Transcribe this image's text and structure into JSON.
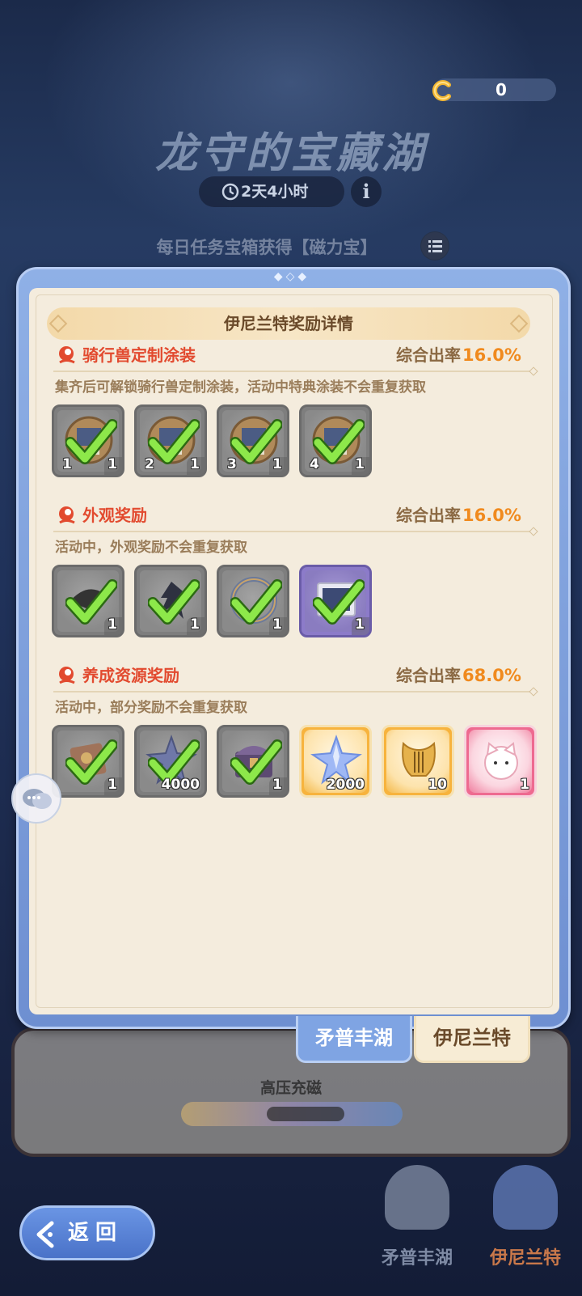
{
  "currency": {
    "value": "0",
    "icon": "horseshoe-magnet-icon"
  },
  "event": {
    "title": "龙守的宝藏湖",
    "timer": "2天4小时",
    "daily_task_text": "每日任务宝箱获得【磁力宝】"
  },
  "modal": {
    "title": "伊尼兰特奖励详情",
    "sections": [
      {
        "title": "骑行兽定制涂装",
        "rate_label": "综合出率",
        "rate_value": "16.0%",
        "desc": "集齐后可解锁骑行兽定制涂装，活动中特典涂装不会重复获取",
        "items": [
          {
            "count": "1",
            "tag": "1",
            "style": "grey",
            "collected": true,
            "icon": "mount-skin-fragment-icon"
          },
          {
            "count": "1",
            "tag": "2",
            "style": "grey",
            "collected": true,
            "icon": "mount-skin-fragment-icon"
          },
          {
            "count": "1",
            "tag": "3",
            "style": "grey",
            "collected": true,
            "icon": "mount-skin-fragment-icon"
          },
          {
            "count": "1",
            "tag": "4",
            "style": "grey",
            "collected": true,
            "icon": "mount-skin-fragment-icon"
          }
        ]
      },
      {
        "title": "外观奖励",
        "rate_label": "综合出率",
        "rate_value": "16.0%",
        "desc": "活动中，外观奖励不会重复获取",
        "items": [
          {
            "count": "1",
            "style": "grey",
            "collected": true,
            "icon": "hat-icon"
          },
          {
            "count": "1",
            "style": "grey",
            "collected": true,
            "icon": "wings-icon"
          },
          {
            "count": "1",
            "style": "grey",
            "collected": true,
            "icon": "avatar-frame-icon"
          },
          {
            "count": "1",
            "style": "purple",
            "collected": true,
            "icon": "photo-frame-icon"
          }
        ]
      },
      {
        "title": "养成资源奖励",
        "rate_label": "综合出率",
        "rate_value": "68.0%",
        "desc": "活动中，部分奖励不会重复获取",
        "items": [
          {
            "count": "1",
            "style": "grey",
            "collected": true,
            "icon": "scroll-icon"
          },
          {
            "count": "4000",
            "style": "grey",
            "collected": true,
            "icon": "star-crystal-icon"
          },
          {
            "count": "1",
            "style": "grey",
            "collected": true,
            "icon": "chest-icon"
          },
          {
            "count": "2000",
            "style": "orange",
            "collected": false,
            "icon": "star-crystal-icon"
          },
          {
            "count": "10",
            "style": "orange",
            "collected": false,
            "icon": "lyre-icon"
          },
          {
            "count": "1",
            "style": "pink",
            "collected": false,
            "icon": "cat-avatar-icon"
          }
        ]
      }
    ]
  },
  "tabs": [
    {
      "label": "矛普丰湖",
      "active": true
    },
    {
      "label": "伊尼兰特",
      "active": false
    }
  ],
  "background": {
    "charge_label": "高压充磁",
    "lakes": [
      "矛普丰湖",
      "伊尼兰特"
    ]
  },
  "back_button": {
    "label": "返回"
  },
  "colors": {
    "accent_red": "#e24a2f",
    "rate_orange": "#f08a1e",
    "frame_blue": "#7fa4e3",
    "paper": "#f4ecdd"
  }
}
